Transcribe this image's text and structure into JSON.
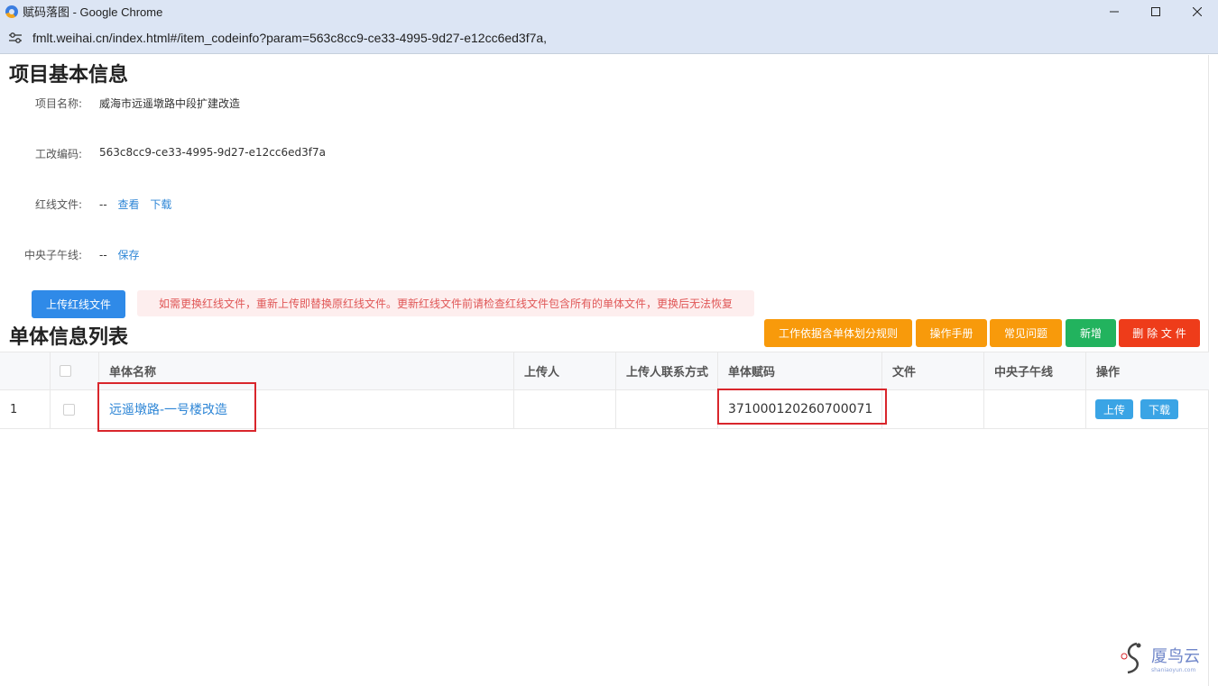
{
  "window": {
    "title": "赋码落图 - Google Chrome",
    "controls": {
      "minimize": "—",
      "maximize": "☐",
      "close": "✕"
    }
  },
  "address": {
    "url": "fmlt.weihai.cn/index.html#/item_codeinfo?param=563c8cc9-ce33-4995-9d27-e12cc6ed3f7a,"
  },
  "basic_info": {
    "title": "项目基本信息",
    "project_name_label": "项目名称:",
    "project_name_value": "威海市远遥墩路中段扩建改造",
    "code_label": "工改编码:",
    "code_value": "563c8cc9-ce33-4995-9d27-e12cc6ed3f7a",
    "redline_label": "红线文件:",
    "redline_value": "--",
    "redline_view": "查看",
    "redline_download": "下载",
    "meridian_label": "中央子午线:",
    "meridian_value": "--",
    "meridian_save": "保存",
    "upload_button": "上传红线文件",
    "warning": "如需更换红线文件，重新上传即替换原红线文件。更新红线文件前请检查红线文件包含所有的单体文件，更换后无法恢复"
  },
  "unit_list": {
    "title": "单体信息列表",
    "toolbar": {
      "rules": "工作依据含单体划分规则",
      "manual": "操作手册",
      "faq": "常见问题",
      "add": "新增",
      "delete": "删 除 文 件"
    },
    "columns": [
      "单体名称",
      "上传人",
      "上传人联系方式",
      "单体赋码",
      "文件",
      "中央子午线",
      "操作"
    ],
    "rows": [
      {
        "index": "1",
        "name": "远遥墩路-一号楼改造",
        "uploader": "",
        "contact": "",
        "code": "371000120260700071",
        "file": "",
        "meridian": "",
        "upload": "上传",
        "download": "下载"
      }
    ]
  },
  "watermark": {
    "brand": "厦鸟云",
    "sub": "shaniaoyun.com"
  },
  "colors": {
    "primary": "#2f8ae8",
    "orange": "#f89a0b",
    "green": "#22b35e",
    "red": "#ee3c1a",
    "light_blue": "#3aa4e5",
    "highlight": "#d9262c"
  }
}
